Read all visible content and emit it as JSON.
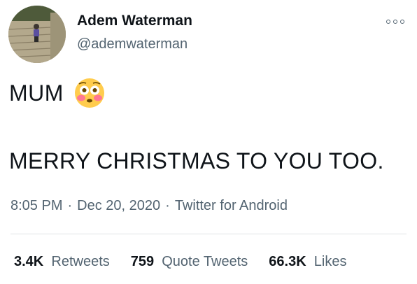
{
  "author": {
    "name": "Adem Waterman",
    "handle": "@ademwaterman"
  },
  "more_icon": "more-horizontal-icon",
  "tweet": {
    "line1": "MUM",
    "emoji": "flushed-face-emoji",
    "line2": "MERRY CHRISTMAS TO YOU TOO."
  },
  "meta": {
    "time": "8:05 PM",
    "separator": "·",
    "date": "Dec 20, 2020",
    "source": "Twitter for Android"
  },
  "stats": {
    "retweets_count": "3.4K",
    "retweets_label": "Retweets",
    "quotes_count": "759",
    "quotes_label": "Quote Tweets",
    "likes_count": "66.3K",
    "likes_label": "Likes"
  }
}
